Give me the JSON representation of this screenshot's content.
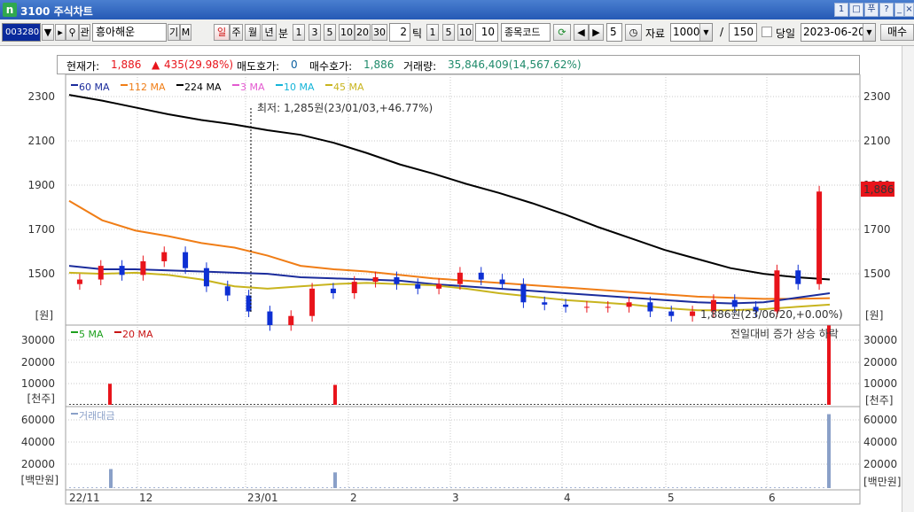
{
  "window": {
    "title": "3100 주식차트",
    "app_icon": "n",
    "buttons": [
      "1",
      "□",
      "푸",
      "?",
      "_",
      "□",
      "×"
    ]
  },
  "toolbar": {
    "code": "003280",
    "name": "흥아해운",
    "btn_gi": "기",
    "btn_m": "M",
    "btn_gwan": "관",
    "periods": [
      "일",
      "주",
      "월",
      "년"
    ],
    "label_bun": "분",
    "min_options": [
      "1",
      "3",
      "5",
      "10",
      "20",
      "30"
    ],
    "tick_value": "2",
    "label_tick": "틱",
    "tick_options": [
      "1",
      "5",
      "10"
    ],
    "tick_input": "10",
    "stock_code_label": "종목코드",
    "step_value": "5",
    "data_label": "자료",
    "data_count": "1000",
    "slash": "/",
    "total": "150",
    "today_label": "당일",
    "date": "2023-06-20",
    "trade_button": "매수"
  },
  "info": {
    "current_label": "현재가:",
    "current_value": "1,886",
    "change": "435(29.98%)",
    "ask_label": "매도호가:",
    "ask_value": "0",
    "bid_label": "매수호가:",
    "bid_value": "1,886",
    "volume_label": "거래량:",
    "volume_value": "35,846,409(14,567.62%)"
  },
  "colors": {
    "up": "#e8141b",
    "down": "#0d2fd3",
    "ma60": "#1b2c9c",
    "ma112": "#f07d16",
    "ma224": "#000000",
    "ma3": "#e35ad0",
    "ma10": "#14b4d8",
    "ma45": "#c8b41e",
    "vol5": "#1ea01e",
    "vol20": "#c81414",
    "amount": "#8aa0c8"
  },
  "chart_data": [
    {
      "type": "candlestick",
      "legend": [
        "60 MA",
        "112 MA",
        "224 MA",
        "3 MA",
        "10 MA",
        "45 MA"
      ],
      "y_ticks": [
        2300,
        2100,
        1900,
        1700,
        1500
      ],
      "y_unit": "[원]",
      "ylim": [
        1300,
        2400
      ],
      "annotations": {
        "low": "최저: 1,285원(23/01/03,+46.77%)",
        "current": "1,886원(23/06/20,+0.00%)",
        "last_price_tag": "1,886"
      },
      "series": [
        {
          "name": "224 MA",
          "values": [
            2310,
            2285,
            2255,
            2225,
            2200,
            2180,
            2155,
            2135,
            2100,
            2055,
            2005,
            1965,
            1920,
            1880,
            1835,
            1785,
            1730,
            1680,
            1630,
            1590,
            1550,
            1525,
            1510,
            1500
          ]
        },
        {
          "name": "112 MA",
          "values": [
            1845,
            1760,
            1715,
            1690,
            1660,
            1640,
            1605,
            1560,
            1545,
            1535,
            1520,
            1505,
            1495,
            1485,
            1475,
            1465,
            1455,
            1445,
            1435,
            1425,
            1420,
            1415,
            1415,
            1418
          ]
        },
        {
          "name": "60 MA",
          "values": [
            1560,
            1545,
            1545,
            1540,
            1535,
            1530,
            1525,
            1510,
            1505,
            1500,
            1495,
            1480,
            1470,
            1460,
            1450,
            1440,
            1430,
            1420,
            1410,
            1400,
            1395,
            1400,
            1420,
            1440
          ]
        },
        {
          "name": "45 MA",
          "values": [
            1530,
            1525,
            1530,
            1520,
            1500,
            1470,
            1460,
            1470,
            1480,
            1485,
            1480,
            1475,
            1460,
            1440,
            1425,
            1410,
            1400,
            1390,
            1375,
            1365,
            1365,
            1370,
            1380,
            1390
          ]
        }
      ],
      "candles": [
        1500,
        1560,
        1520,
        1580,
        1620,
        1550,
        1470,
        1430,
        1360,
        1300,
        1340,
        1460,
        1440,
        1490,
        1510,
        1480,
        1460,
        1480,
        1530,
        1500,
        1480,
        1400,
        1390,
        1380,
        1380,
        1380,
        1400,
        1360,
        1340,
        1360,
        1410,
        1380,
        1360,
        1540,
        1480,
        1886
      ]
    },
    {
      "type": "bar",
      "legend": [
        "5 MA",
        "20 MA"
      ],
      "note": "전일대비 증가 상승 하락",
      "y_ticks": [
        30000,
        20000,
        10000
      ],
      "y_unit": "[천주]",
      "ylim": [
        0,
        36000
      ],
      "spikes": [
        {
          "x": "22/11",
          "value": 9500
        },
        {
          "x": "2",
          "value": 9000
        },
        {
          "x": "6/20",
          "value": 35846
        }
      ]
    },
    {
      "type": "bar",
      "legend": [
        "거래대금"
      ],
      "y_ticks": [
        60000,
        40000,
        20000
      ],
      "y_unit": "[백만원]",
      "ylim": [
        0,
        68000
      ],
      "spikes": [
        {
          "x": "12",
          "value": 17000
        },
        {
          "x": "2",
          "value": 14000
        },
        {
          "x": "6/20",
          "value": 66000
        }
      ]
    }
  ],
  "x_axis": [
    "22/11",
    "12",
    "23/01",
    "2",
    "3",
    "4",
    "5",
    "6"
  ]
}
